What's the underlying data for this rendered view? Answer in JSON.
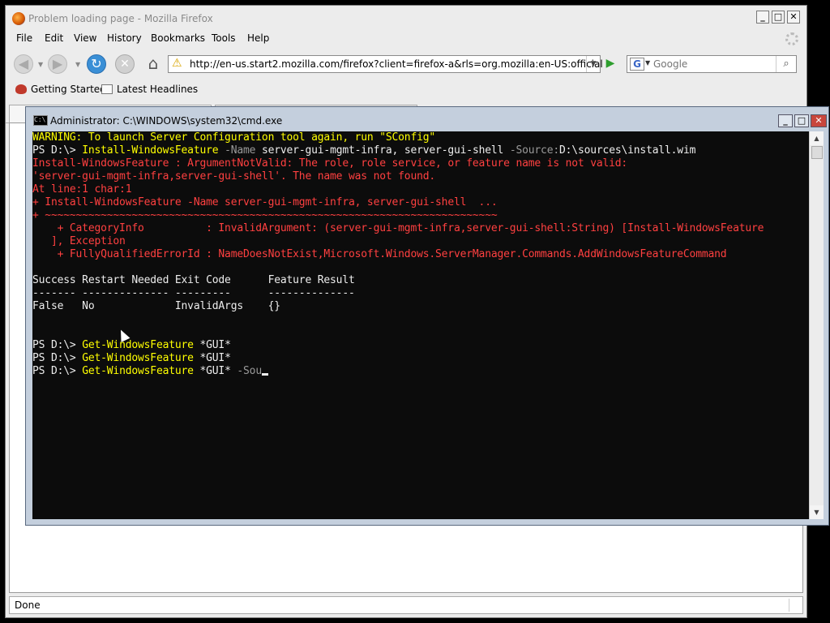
{
  "firefox": {
    "title": "Problem loading page - Mozilla Firefox",
    "window_buttons": [
      "_",
      "□",
      "✕"
    ],
    "menu": [
      "File",
      "Edit",
      "View",
      "History",
      "Bookmarks",
      "Tools",
      "Help"
    ],
    "url": "http://en-us.start2.mozilla.com/firefox?client=firefox-a&rls=org.mozilla:en-US:official",
    "search_placeholder": "Google",
    "bookmarks": [
      "Getting Started",
      "Latest Headlines"
    ],
    "status": "Done"
  },
  "cmd": {
    "title": "Administrator: C:\\WINDOWS\\system32\\cmd.exe",
    "window_buttons": [
      "_",
      "□",
      "✕"
    ],
    "lines": [
      {
        "text": "WARNING: To launch Server Configuration tool again, run \"SConfig\"",
        "color": "warn"
      },
      {
        "parts": [
          {
            "text": "PS D:\\> ",
            "color": "white"
          },
          {
            "text": "Install-WindowsFeature ",
            "color": "cmd"
          },
          {
            "text": "-Name ",
            "color": "gray"
          },
          {
            "text": "server-gui-mgmt-infra, server-gui-shell ",
            "color": "white"
          },
          {
            "text": "-Source:",
            "color": "gray"
          },
          {
            "text": "D:\\sources\\install.wim",
            "color": "white"
          }
        ]
      },
      {
        "text": "Install-WindowsFeature : ArgumentNotValid: The role, role service, or feature name is not valid:",
        "color": "red"
      },
      {
        "text": "'server-gui-mgmt-infra,server-gui-shell'. The name was not found.",
        "color": "red"
      },
      {
        "text": "At line:1 char:1",
        "color": "red"
      },
      {
        "text": "+ Install-WindowsFeature -Name server-gui-mgmt-infra, server-gui-shell  ...",
        "color": "red"
      },
      {
        "text": "+ ~~~~~~~~~~~~~~~~~~~~~~~~~~~~~~~~~~~~~~~~~~~~~~~~~~~~~~~~~~~~~~~~~~~~~~~~~",
        "color": "red"
      },
      {
        "text": "    + CategoryInfo          : InvalidArgument: (server-gui-mgmt-infra,server-gui-shell:String) [Install-WindowsFeature",
        "color": "red"
      },
      {
        "text": "   ], Exception",
        "color": "red"
      },
      {
        "text": "    + FullyQualifiedErrorId : NameDoesNotExist,Microsoft.Windows.ServerManager.Commands.AddWindowsFeatureCommand",
        "color": "red"
      },
      {
        "text": "",
        "color": "white"
      },
      {
        "text": "Success Restart Needed Exit Code      Feature Result",
        "color": "white"
      },
      {
        "text": "------- -------------- ---------      --------------",
        "color": "white"
      },
      {
        "text": "False   No             InvalidArgs    {}",
        "color": "white"
      },
      {
        "text": "",
        "color": "white"
      },
      {
        "text": "",
        "color": "white"
      },
      {
        "parts": [
          {
            "text": "PS D:\\> ",
            "color": "white"
          },
          {
            "text": "Get-WindowsFeature ",
            "color": "cmd"
          },
          {
            "text": "*GUI*",
            "color": "white"
          }
        ]
      },
      {
        "parts": [
          {
            "text": "PS D:\\> ",
            "color": "white"
          },
          {
            "text": "Get-WindowsFeature ",
            "color": "cmd"
          },
          {
            "text": "*GUI*",
            "color": "white"
          }
        ]
      },
      {
        "parts": [
          {
            "text": "PS D:\\> ",
            "color": "white"
          },
          {
            "text": "Get-WindowsFeature ",
            "color": "cmd"
          },
          {
            "text": "*GUI* ",
            "color": "white"
          },
          {
            "text": "-Sou",
            "color": "gray"
          }
        ],
        "cursor": true
      }
    ]
  }
}
